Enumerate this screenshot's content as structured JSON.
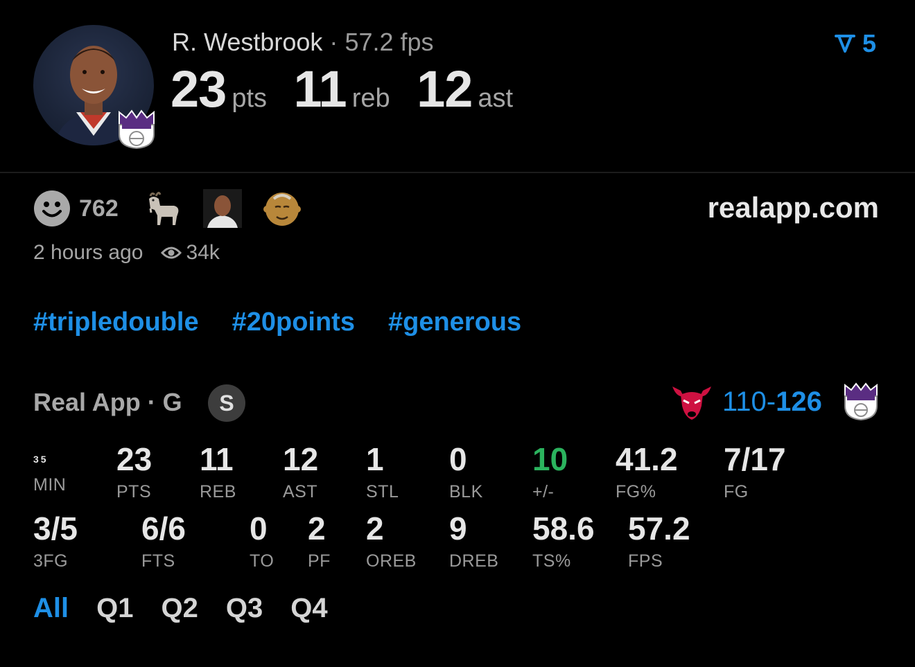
{
  "player": {
    "name": "R. Westbrook",
    "separator": "·",
    "fps": "57.2 fps",
    "pts": "23",
    "pts_unit": "pts",
    "reb": "11",
    "reb_unit": "reb",
    "ast": "12",
    "ast_unit": "ast",
    "team_logo_icon": "sacramento-kings-logo"
  },
  "filter": {
    "icon": "filter-icon",
    "count": "5"
  },
  "reactions": {
    "count": "762",
    "icons": [
      "smiley-face-icon",
      "goat-emoji",
      "player-face-sticker",
      "old-man-emoji"
    ]
  },
  "site": "realapp.com",
  "meta": {
    "time": "2 hours ago",
    "views": "34k",
    "views_icon": "eye-icon"
  },
  "tags": [
    "#tripledouble",
    "#20points",
    "#generous"
  ],
  "game": {
    "label": "Real App · G",
    "badge": "S",
    "away_logo": "chicago-bulls-logo",
    "home_logo": "sacramento-kings-logo",
    "score_away": "110",
    "score_dash": "-",
    "score_home": "126"
  },
  "stats": {
    "row1": [
      {
        "value": "35",
        "label": "MIN"
      },
      {
        "value": "23",
        "label": "PTS"
      },
      {
        "value": "11",
        "label": "REB"
      },
      {
        "value": "12",
        "label": "AST"
      },
      {
        "value": "1",
        "label": "STL"
      },
      {
        "value": "0",
        "label": "BLK"
      },
      {
        "value": "10",
        "label": "+/-"
      },
      {
        "value": "41.2",
        "label": "FG%"
      },
      {
        "value": "7/17",
        "label": "FG"
      }
    ],
    "row2": [
      {
        "value": "3/5",
        "label": "3FG"
      },
      {
        "value": "6/6",
        "label": "FTS"
      },
      {
        "value": "0",
        "label": "TO"
      },
      {
        "value": "2",
        "label": "PF"
      },
      {
        "value": "2",
        "label": "OREB"
      },
      {
        "value": "9",
        "label": "DREB"
      },
      {
        "value": "58.6",
        "label": "TS%"
      },
      {
        "value": "57.2",
        "label": "FPS"
      }
    ]
  },
  "quarters": [
    "All",
    "Q1",
    "Q2",
    "Q3",
    "Q4"
  ],
  "colors": {
    "accent": "#1e8fe6",
    "positive": "#2bb35e",
    "background": "#000000"
  }
}
